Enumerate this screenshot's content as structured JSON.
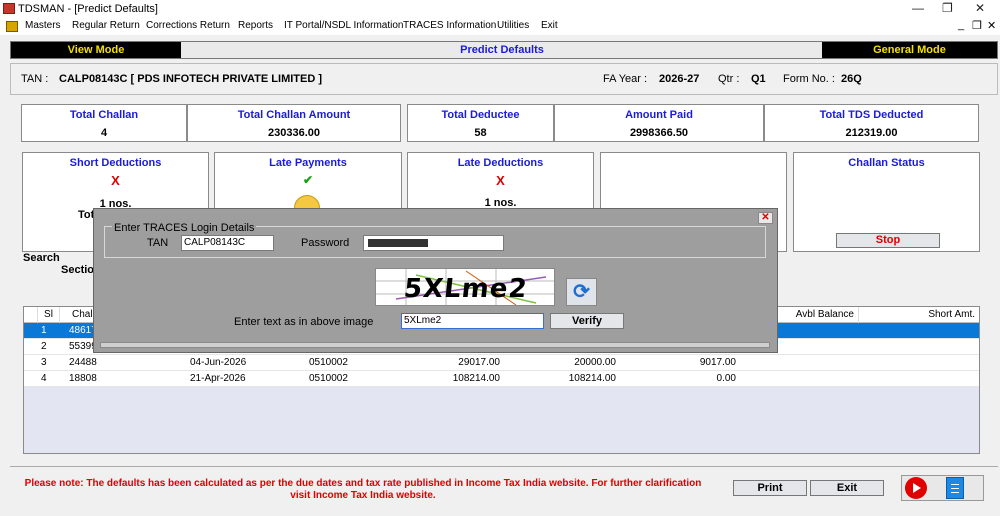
{
  "window": {
    "title": "TDSMAN - [Predict Defaults]"
  },
  "menu": [
    "Masters",
    "Regular Return",
    "Corrections Return",
    "Reports",
    "IT Portal/NSDL Information",
    "TRACES Information",
    "Utilities",
    "Exit"
  ],
  "modebar": {
    "left": "View Mode",
    "center": "Predict Defaults",
    "right": "General Mode"
  },
  "info": {
    "tan_label": "TAN :",
    "tan_value": "CALP08143C [ PDS INFOTECH PRIVATE LIMITED ]",
    "fy_label": "FA Year :",
    "fy_value": "2026-27",
    "qtr_label": "Qtr :",
    "qtr_value": "Q1",
    "form_label": "Form No. :",
    "form_value": "26Q"
  },
  "summary": [
    {
      "title": "Total Challan",
      "value": "4"
    },
    {
      "title": "Total Challan Amount",
      "value": "230336.00"
    },
    {
      "title": "Total Deductee",
      "value": "58"
    },
    {
      "title": "Amount Paid",
      "value": "2998366.50"
    },
    {
      "title": "Total TDS Deducted",
      "value": "212319.00"
    }
  ],
  "status": {
    "short_title": "Short Deductions",
    "short_mark": "X",
    "short_count": "1 nos.",
    "short_partial": "Tot",
    "late_pay_title": "Late Payments",
    "late_pay_mark": "✔",
    "late_ded_title": "Late Deductions",
    "late_ded_mark": "X",
    "late_ded_count": "1 nos.",
    "challan_title": "Challan Status",
    "stop_label": "Stop"
  },
  "search": {
    "label": "Search",
    "section": "Sectio"
  },
  "grid": {
    "headers": {
      "sl": "Sl",
      "challan": "Chall",
      "avbl": "Avbl Balance",
      "short": "Short Amt."
    },
    "rows": [
      {
        "sl": "1",
        "challan": "48617",
        "date": "",
        "bsr": "",
        "amount": "",
        "consumed": "",
        "balance": ""
      },
      {
        "sl": "2",
        "challan": "55399",
        "date": "",
        "bsr": "",
        "amount": "",
        "consumed": "",
        "balance": ""
      },
      {
        "sl": "3",
        "challan": "24488",
        "date": "04-Jun-2026",
        "bsr": "0510002",
        "amount": "29017.00",
        "consumed": "20000.00",
        "balance": "9017.00"
      },
      {
        "sl": "4",
        "challan": "18808",
        "date": "21-Apr-2026",
        "bsr": "0510002",
        "amount": "108214.00",
        "consumed": "108214.00",
        "balance": "0.00"
      }
    ]
  },
  "note": "Please note: The defaults has been calculated as per the due dates and tax rate published in Income Tax India website. For further clarification visit Income Tax India website.",
  "buttons": {
    "print": "Print",
    "exit": "Exit"
  },
  "dialog": {
    "group_title": "Enter TRACES Login Details",
    "tan_label": "TAN",
    "tan_value": "CALP08143C",
    "password_label": "Password",
    "captcha_text": "5XLme2",
    "captcha_label": "Enter text as in above image",
    "captcha_input": "5XLme2",
    "verify_label": "Verify"
  },
  "colors": {
    "accent_blue": "#1a1ae0",
    "alert_red": "#e00000",
    "selection": "#0a78d7",
    "mode_text": "#f5e000"
  }
}
